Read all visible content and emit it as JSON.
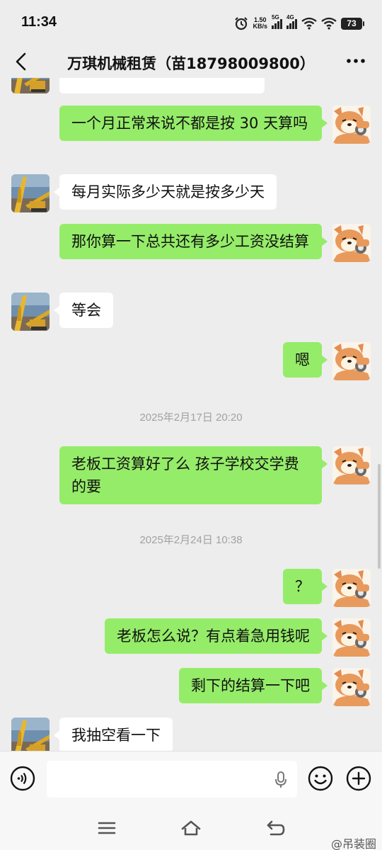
{
  "status_bar": {
    "time": "11:34",
    "net_speed_value": "1.50",
    "net_speed_unit": "KB/s",
    "sim1_label": "5G",
    "sim2_label": "4G",
    "battery": "73"
  },
  "header": {
    "title": "万琪机械租赁（苗18798009800）"
  },
  "messages": [
    {
      "side": "me",
      "text": "一个月正常来说不都是按 30 天算吗"
    },
    {
      "side": "them",
      "text": "每月实际多少天就是按多少天"
    },
    {
      "side": "me",
      "text": "那你算一下总共还有多少工资没结算"
    },
    {
      "side": "them",
      "text": "等会"
    },
    {
      "side": "me",
      "text": "嗯"
    },
    {
      "side": "time",
      "text": "2025年2月17日 20:20"
    },
    {
      "side": "me",
      "text": "老板工资算好了么 孩子学校交学费的要"
    },
    {
      "side": "time",
      "text": "2025年2月24日 10:38"
    },
    {
      "side": "me",
      "text": "？"
    },
    {
      "side": "me",
      "text": "老板怎么说？有点着急用钱呢"
    },
    {
      "side": "me",
      "text": "剩下的结算一下吧"
    },
    {
      "side": "them",
      "text": "我抽空看一下"
    }
  ],
  "input": {
    "value": "",
    "voice_icon": "voice-icon",
    "emoji_icon": "emoji-icon",
    "plus_icon": "plus-icon"
  },
  "watermark": "@吊装圈",
  "colors": {
    "my_bubble": "#95ec69",
    "their_bubble": "#ffffff",
    "background": "#ededed"
  }
}
